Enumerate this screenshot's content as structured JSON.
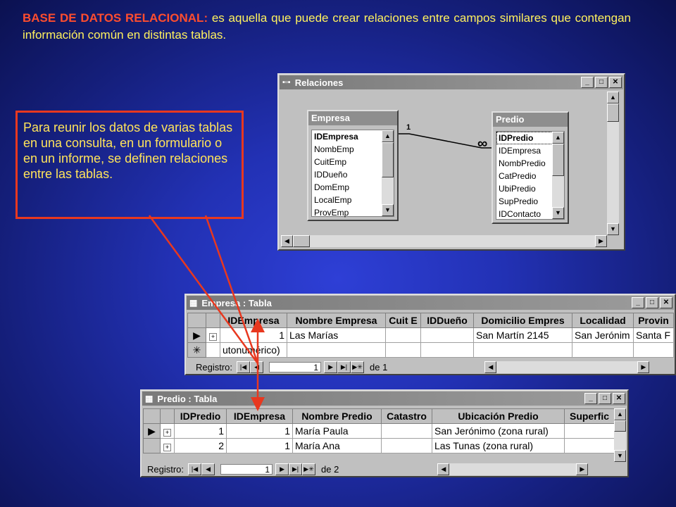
{
  "heading": {
    "bold": "BASE DE DATOS RELACIONAL:",
    "text": " es aquella que puede crear relaciones entre campos similares que contengan información común en distintas tablas."
  },
  "note": "Para reunir los datos de varias tablas en una consulta, en un formulario o en un informe, se definen relaciones entre las tablas.",
  "relaciones_window": {
    "title": "Relaciones",
    "rel_one": "1",
    "rel_many": "∞",
    "empresa": {
      "title": "Empresa",
      "fields": [
        "IDEmpresa",
        "NombEmp",
        "CuitEmp",
        "IDDueño",
        "DomEmp",
        "LocalEmp",
        "ProvEmp"
      ]
    },
    "predio": {
      "title": "Predio",
      "fields": [
        "IDPredio",
        "IDEmpresa",
        "NombPredio",
        "CatPredio",
        "UbiPredio",
        "SupPredio",
        "IDContacto"
      ]
    }
  },
  "empresa_table": {
    "title": "Empresa : Tabla",
    "columns": [
      "IDEmpresa",
      "Nombre Empresa",
      "Cuit E",
      "IDDueño",
      "Domicilio Empres",
      "Localidad",
      "Provin"
    ],
    "row1": [
      "1",
      "Las Marías",
      "",
      "",
      "San Martín 2145",
      "San Jerónim",
      "Santa F"
    ],
    "new_row": "utonumérico)",
    "nav": {
      "label": "Registro:",
      "record": "1",
      "of": "de 1"
    }
  },
  "predio_table": {
    "title": "Predio : Tabla",
    "columns": [
      "IDPredio",
      "IDEmpresa",
      "Nombre Predio",
      "Catastro",
      "Ubicación Predio",
      "Superfic"
    ],
    "rows": [
      [
        "1",
        "1",
        "María Paula",
        "",
        "San Jerónimo (zona rural)",
        ""
      ],
      [
        "2",
        "1",
        "María Ana",
        "",
        "Las Tunas (zona rural)",
        ""
      ]
    ],
    "nav": {
      "label": "Registro:",
      "record": "1",
      "of": "de 2"
    }
  },
  "colors": {
    "heading_text": "#fff15e",
    "heading_bold": "#ff4d2e",
    "note_border": "#e8381f",
    "arrows": "#e8381f"
  }
}
